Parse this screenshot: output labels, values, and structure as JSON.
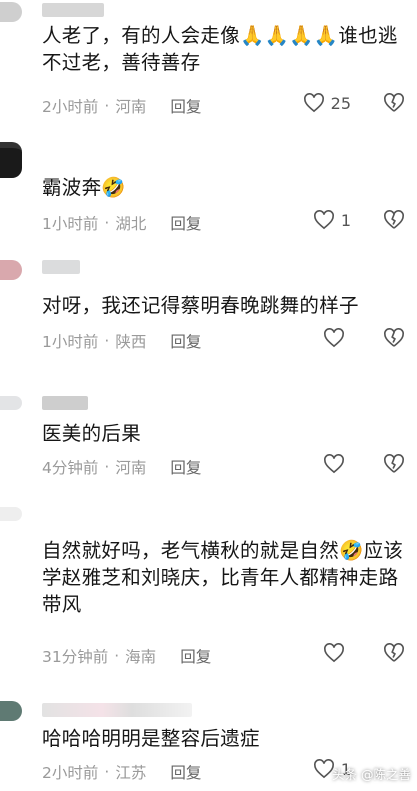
{
  "comments": [
    {
      "text": "人老了，有的人会走像🙏🙏🙏🙏谁也逃不过老，善待善存",
      "time": "2小时前",
      "location": "河南",
      "reply_label": "回复",
      "likes": "25"
    },
    {
      "text": "霸波奔🤣",
      "time": "1小时前",
      "location": "湖北",
      "reply_label": "回复",
      "likes": "1"
    },
    {
      "text": "对呀，我还记得蔡明春晚跳舞的样子",
      "time": "1小时前",
      "location": "陕西",
      "reply_label": "回复",
      "likes": ""
    },
    {
      "text": "医美的后果",
      "time": "4分钟前",
      "location": "河南",
      "reply_label": "回复",
      "likes": ""
    },
    {
      "text": "自然就好吗，老气横秋的就是自然🤣应该学赵雅芝和刘晓庆，比青年人都精神走路带风",
      "time": "31分钟前",
      "location": "海南",
      "reply_label": "回复",
      "likes": ""
    },
    {
      "text": "哈哈哈明明是整容后遗症",
      "time": "2小时前",
      "location": "江苏",
      "reply_label": "回复",
      "likes": "1"
    }
  ],
  "separator": "·",
  "watermark": "头条 @陈之善",
  "colors": {
    "meta_gray": "#9a9a9a",
    "icon_gray": "#555555"
  },
  "icons": {
    "like": "heart-outline-icon",
    "dislike": "broken-heart-icon"
  }
}
